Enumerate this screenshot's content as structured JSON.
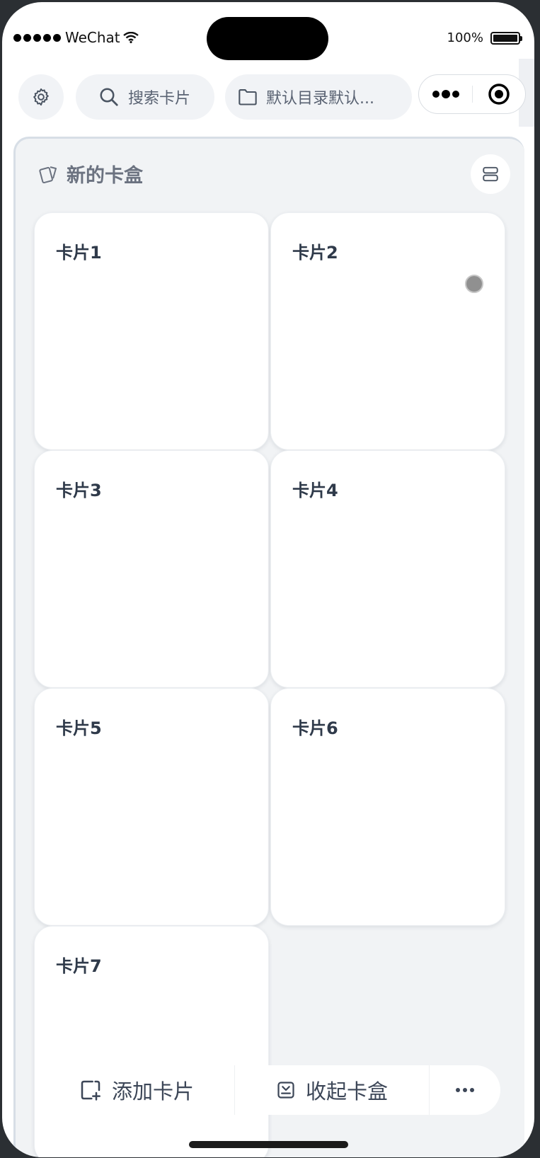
{
  "status_bar": {
    "carrier": "WeChat",
    "battery_text": "100%",
    "battery_level": 1.0
  },
  "toolbar": {
    "search_label": "搜索卡片",
    "folder_label": "默认目录默认..."
  },
  "panel": {
    "title": "新的卡盒"
  },
  "cards": [
    {
      "label": "卡片1"
    },
    {
      "label": "卡片2"
    },
    {
      "label": "卡片3"
    },
    {
      "label": "卡片4"
    },
    {
      "label": "卡片5"
    },
    {
      "label": "卡片6"
    },
    {
      "label": "卡片7"
    }
  ],
  "bottom_bar": {
    "add_label": "添加卡片",
    "collapse_label": "收起卡盒"
  },
  "icons": {
    "settings": "gear-icon",
    "search": "search-icon",
    "folder": "folder-icon",
    "capsule_more": "more-dots-icon",
    "capsule_close": "target-icon",
    "panel": "cards-icon",
    "layout": "list-layout-icon",
    "add": "add-card-icon",
    "collapse": "collapse-box-icon",
    "bottom_more": "ellipsis-icon"
  },
  "colors": {
    "panel_bg": "#f1f3f5",
    "card_bg": "#ffffff",
    "text_dark": "#2f3a4a",
    "text_muted": "#6b7280",
    "pill_bg": "#f1f3f6"
  }
}
